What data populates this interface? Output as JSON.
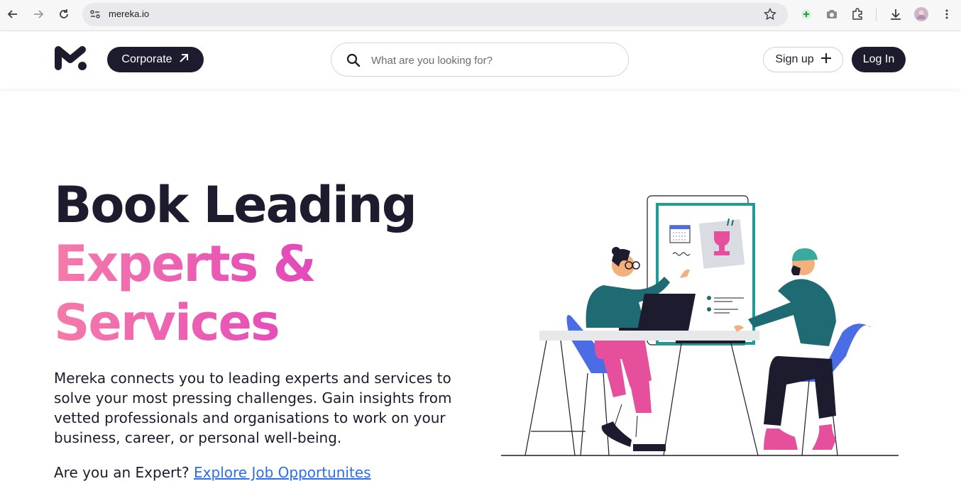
{
  "browser": {
    "url": "mereka.io"
  },
  "header": {
    "corporate_label": "Corporate",
    "search_placeholder": "What are you looking for?",
    "signup_label": "Sign up",
    "login_label": "Log In"
  },
  "hero": {
    "title_line1": "Book Leading",
    "title_line2": "Experts &",
    "title_line3": "Services",
    "description": "Mereka connects you to leading experts and services to solve your most pressing challenges. Gain insights from vetted professionals and organisations to work on your business, career, or personal well-being.",
    "expert_question": "Are you an Expert?",
    "expert_link": "Explore Job Opportunites"
  },
  "colors": {
    "brand_dark": "#1d1b2e",
    "accent_pink": "#e64fb8",
    "link_blue": "#2f6ee6",
    "teal": "#1f6b73",
    "chair_blue": "#4a6de5"
  },
  "icons": [
    "back-icon",
    "forward-icon",
    "reload-icon",
    "site-info-icon",
    "star-icon",
    "add-extension-icon",
    "camera-icon",
    "extensions-icon",
    "download-icon",
    "profile-avatar",
    "more-menu-icon",
    "mereka-logo",
    "arrow-up-right-icon",
    "search-icon",
    "plus-icon"
  ]
}
